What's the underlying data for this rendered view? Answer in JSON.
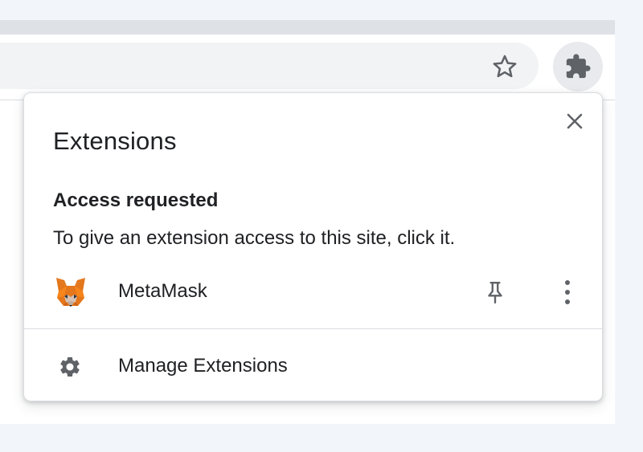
{
  "toolbar": {
    "bookmark_icon": "star-outline-icon",
    "extensions_icon": "puzzle-piece-icon"
  },
  "popup": {
    "title": "Extensions",
    "close_icon": "close-icon",
    "access_section": {
      "heading": "Access requested",
      "description": "To give an extension access to this site, click it."
    },
    "extensions": [
      {
        "name": "MetaMask",
        "icon": "metamask-fox-icon",
        "pin_icon": "pin-icon",
        "menu_icon": "more-vert-icon"
      }
    ],
    "manage": {
      "label": "Manage Extensions",
      "icon": "gear-icon"
    }
  },
  "colors": {
    "page_background": "#f2f6fb",
    "tabstrip": "#dee1e6",
    "omnibox": "#f1f3f4",
    "icon_gray": "#5f6368",
    "text": "#202124",
    "divider": "#dadce0"
  }
}
